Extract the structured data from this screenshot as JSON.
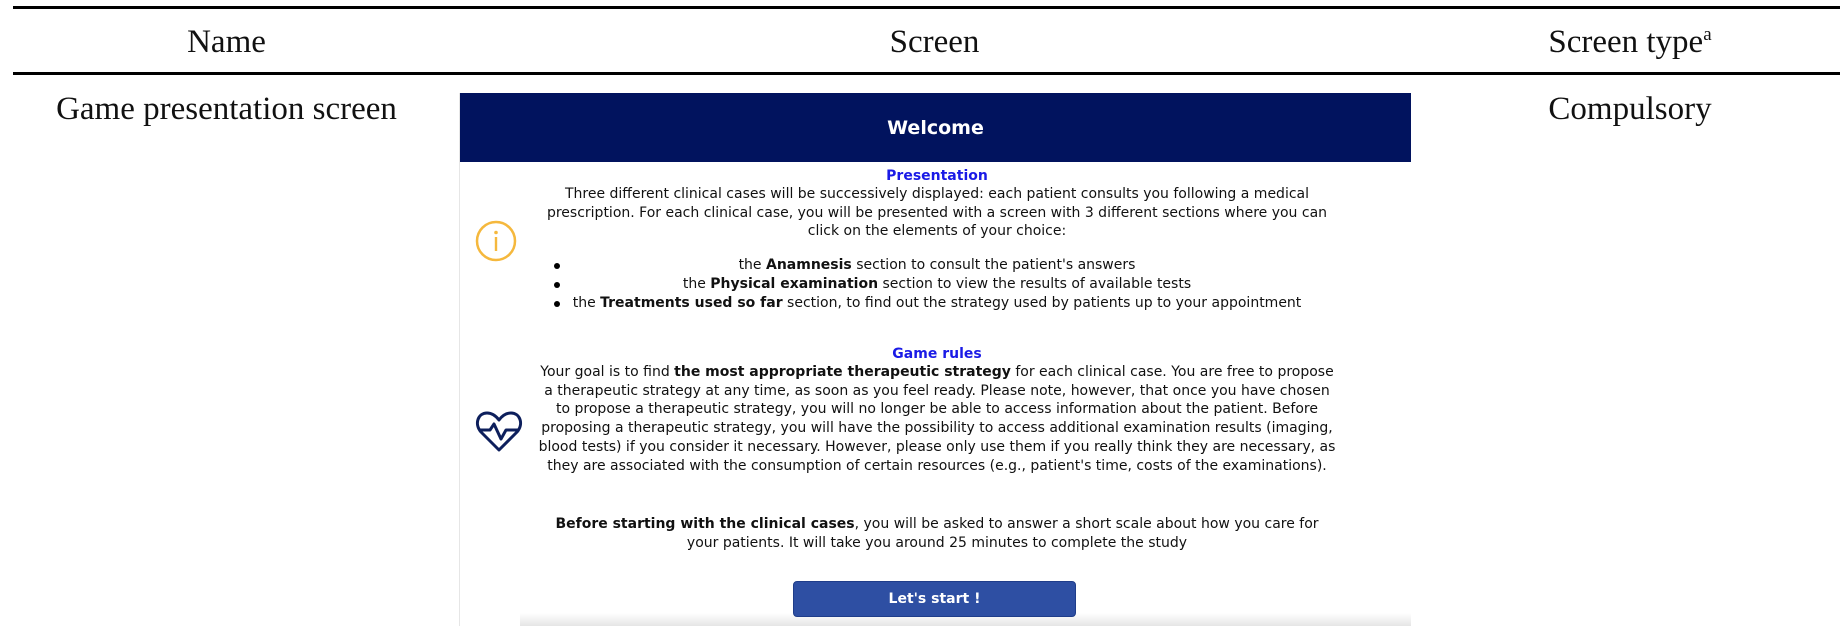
{
  "table": {
    "headers": {
      "name": "Name",
      "screen": "Screen",
      "screen_type": "Screen type",
      "screen_type_sup": "a"
    },
    "row": {
      "name": "Game presentation screen",
      "screen_type": "Compulsory"
    }
  },
  "screen": {
    "banner": "Welcome",
    "presentation": {
      "title": "Presentation",
      "intro": "Three different clinical cases will be successively displayed: each patient consults you following a medical prescription. For each clinical case, you will be presented with a screen with 3 different sections where you can click on the elements of your choice:",
      "bullets": [
        {
          "pre": "the ",
          "bold": "Anamnesis",
          "post": " section to consult the patient's answers"
        },
        {
          "pre": "the ",
          "bold": "Physical examination",
          "post": " section to view the results of available tests"
        },
        {
          "pre": "the ",
          "bold": "Treatments used so far",
          "post": " section, to find out the strategy used by patients up to your appointment"
        }
      ]
    },
    "rules": {
      "title": "Game rules",
      "pre": "Your goal is to find ",
      "bold": "the most appropriate therapeutic strategy",
      "post": " for each clinical case. You are free to propose a therapeutic strategy at any time, as soon as you feel ready. Please note, however, that once you have chosen to propose a therapeutic strategy, you will no longer be able to access information about the patient. Before proposing a therapeutic strategy, you will have the possibility to access additional examination results (imaging, blood tests) if you consider it necessary. However, please only use them if you really think they are necessary, as they are associated with the consumption of certain resources (e.g., patient's time, costs of the examinations)."
    },
    "before": {
      "bold": "Before starting with the clinical cases",
      "post": ", you will be asked to answer a short scale about how you care for your patients. It will take you around 25 minutes to complete the study"
    },
    "start_button": "Let's start !"
  },
  "icons": {
    "info": "info-icon",
    "heart": "heart-pulse-icon"
  },
  "colors": {
    "banner_bg": "#01135e",
    "section_title": "#1a1ae6",
    "info_icon": "#f5b83d",
    "heart_icon": "#0d1f5c",
    "button_bg": "#2e4fa3"
  }
}
